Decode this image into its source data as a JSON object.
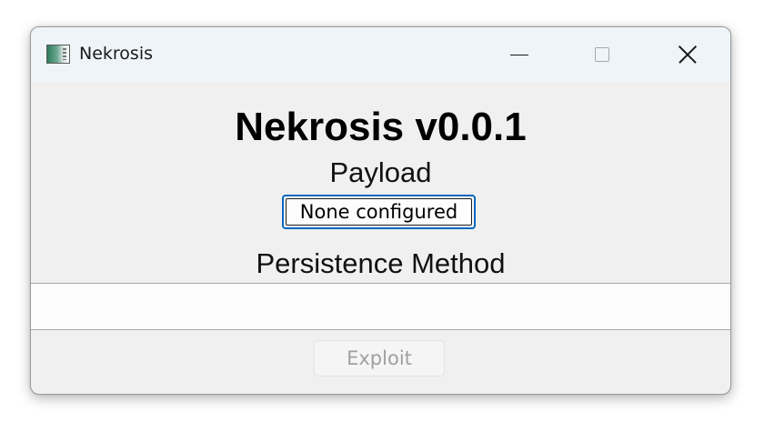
{
  "window": {
    "title": "Nekrosis",
    "icon": "app-window-icon",
    "controls": [
      "minimize-icon",
      "maximize-icon",
      "close-icon"
    ]
  },
  "main": {
    "app_title": "Nekrosis v0.0.1",
    "payload_label": "Payload",
    "payload_button_label": "None configured",
    "persistence_label": "Persistence Method",
    "persistence_options": [],
    "exploit_button_label": "Exploit",
    "exploit_enabled": false
  },
  "colors": {
    "focus_accent": "#0067c0",
    "disabled_text": "#a0a0a0",
    "titlebar_bg": "#eff4f9",
    "window_bg": "#f0f0f0"
  }
}
